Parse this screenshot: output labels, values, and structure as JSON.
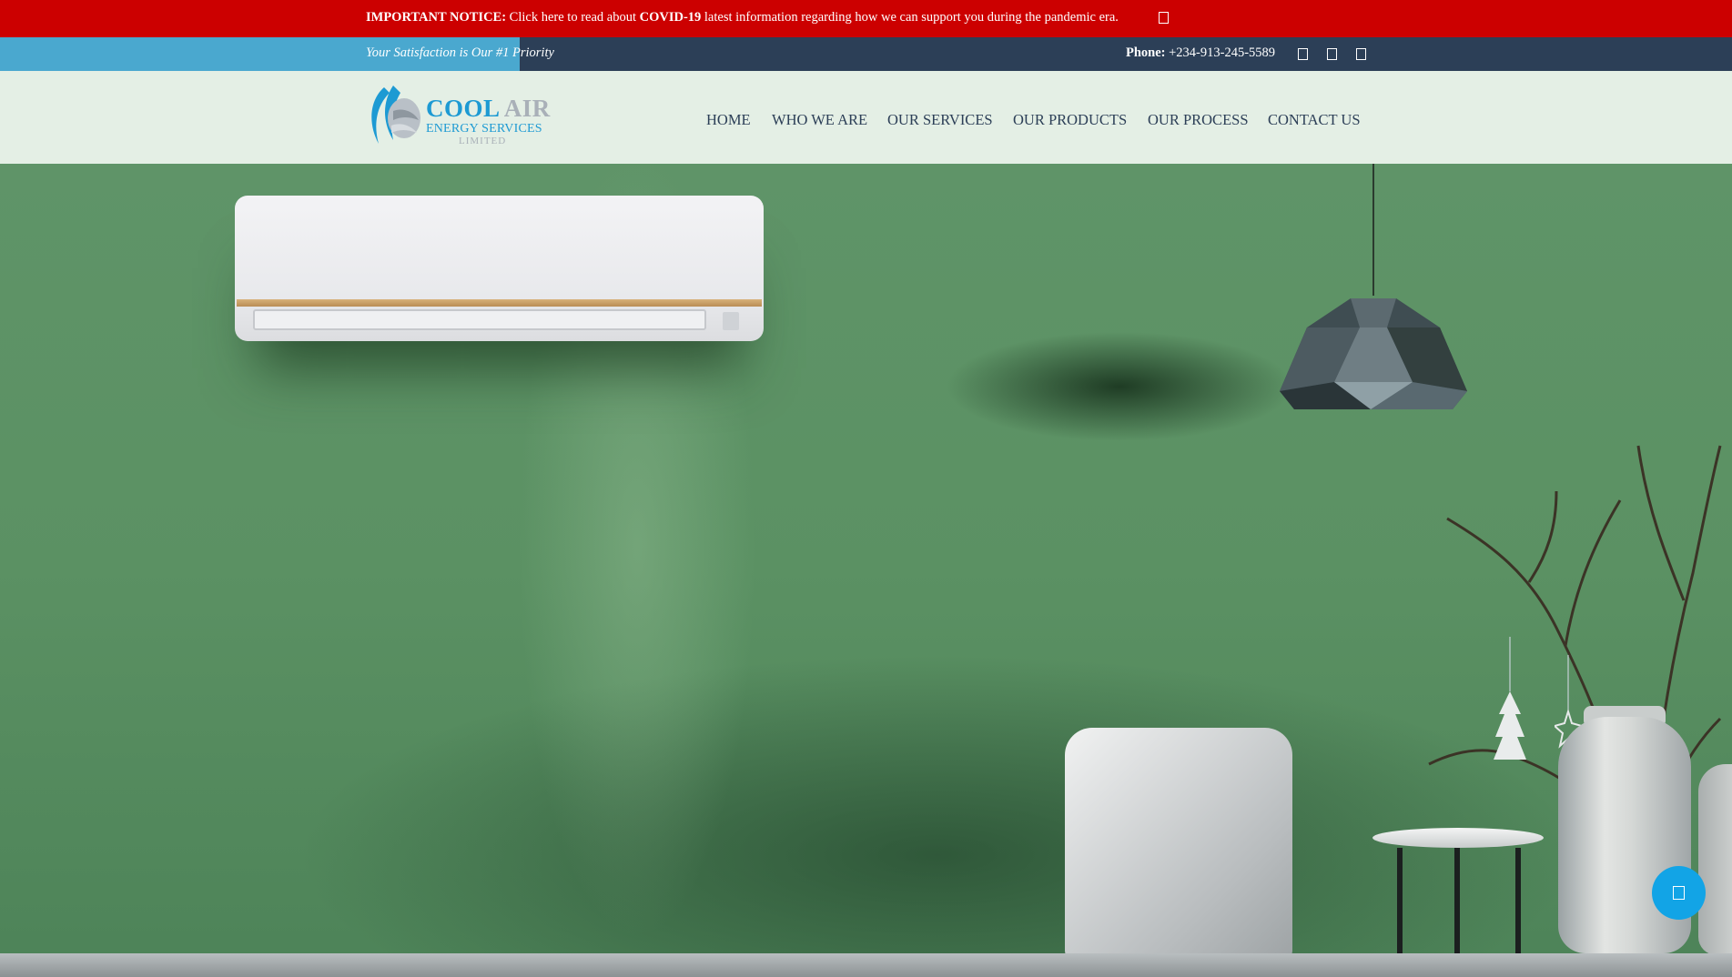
{
  "notice": {
    "label": "IMPORTANT NOTICE:",
    "text_before": " Click here to read about ",
    "highlight": "COVID-19",
    "text_after": " latest information regarding how we can support you during the pandemic era.",
    "close_icon": "close-icon"
  },
  "topbar": {
    "tagline": "Your Satisfaction is Our #1 Priority",
    "phone_label": "Phone:",
    "phone_number": " +234-913-245-5589",
    "social_icons": [
      "facebook-icon",
      "twitter-icon",
      "instagram-icon"
    ]
  },
  "logo": {
    "word1": "COOL",
    "word2": " AIR",
    "line2": "ENERGY SERVICES",
    "line3": "LIMITED"
  },
  "nav": {
    "items": [
      {
        "label": "HOME"
      },
      {
        "label": "WHO WE ARE"
      },
      {
        "label": "OUR SERVICES"
      },
      {
        "label": "OUR PRODUCTS"
      },
      {
        "label": "OUR PROCESS"
      },
      {
        "label": "CONTACT US"
      }
    ]
  },
  "fab": {
    "icon": "chat-icon"
  },
  "colors": {
    "notice_bg": "#cc0000",
    "topbar_bg": "#2c3f57",
    "topbar_accent": "#4aa8cf",
    "brand_blue": "#1d9ad3",
    "hero_green": "#5b9163",
    "fab_blue": "#12a4e6"
  }
}
